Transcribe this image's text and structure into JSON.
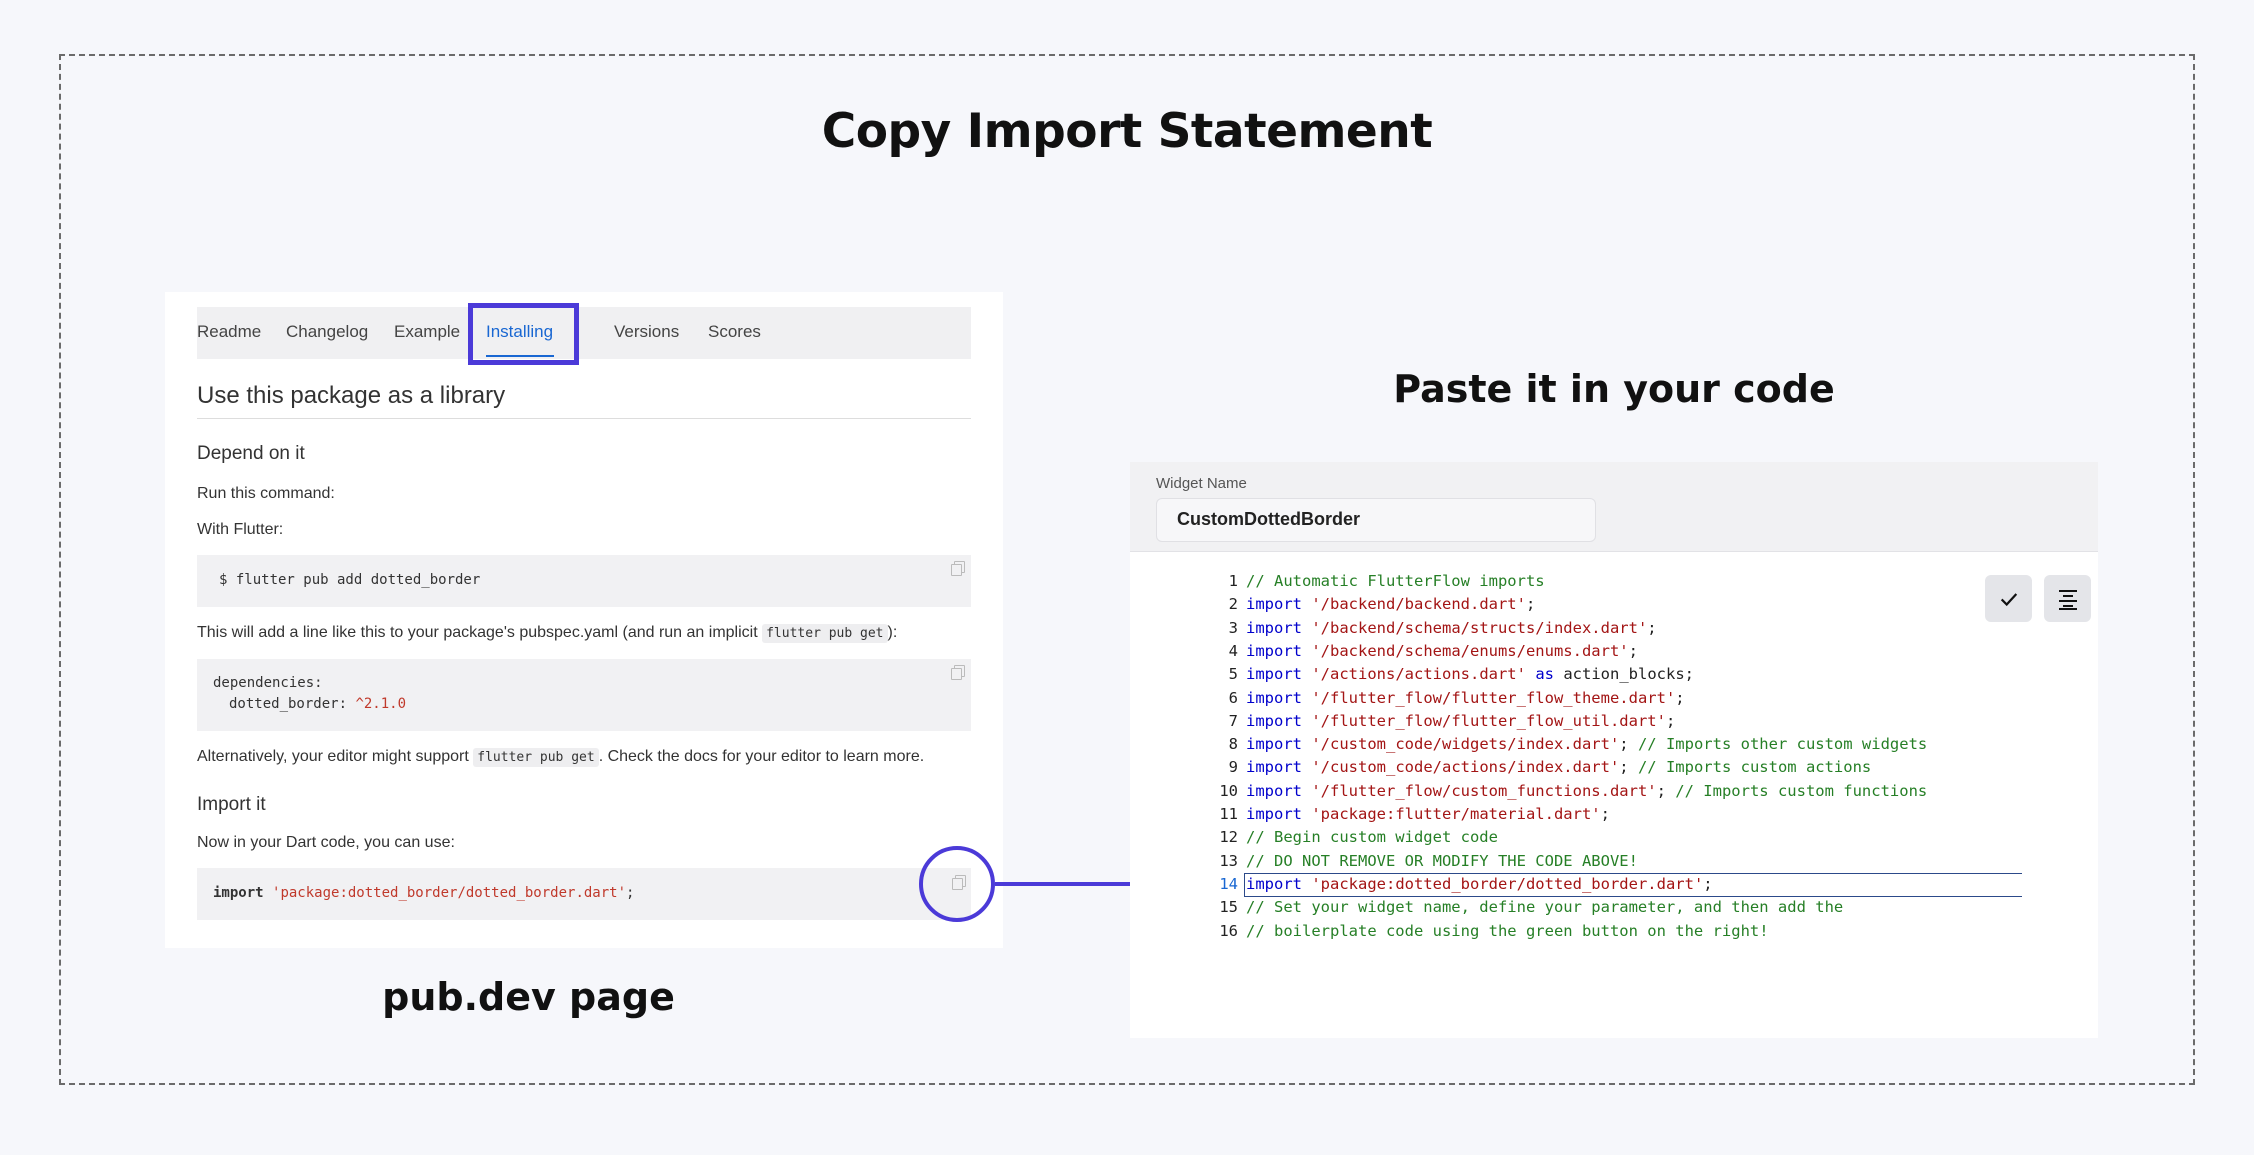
{
  "main_title": "Copy Import Statement",
  "pub_caption": "pub.dev page",
  "paste_title": "Paste it in your code",
  "pub_page": {
    "tabs": [
      {
        "label": "Readme",
        "active": false
      },
      {
        "label": "Changelog",
        "active": false
      },
      {
        "label": "Example",
        "active": false
      },
      {
        "label": "Installing",
        "active": true
      },
      {
        "label": "Versions",
        "active": false
      },
      {
        "label": "Scores",
        "active": false
      }
    ],
    "heading": "Use this package as a library",
    "depend_heading": "Depend on it",
    "run_command": "Run this command:",
    "with_flutter": "With Flutter:",
    "command": "$ flutter pub add dotted_border",
    "will_add_before": "This will add a line like this to your package's pubspec.yaml (and run an implicit ",
    "will_add_code": "flutter pub get",
    "will_add_after": "):",
    "deps_key": "dependencies:",
    "deps_name": "dotted_border: ",
    "deps_version": "^2.1.0",
    "alt_before": "Alternatively, your editor might support ",
    "alt_code": "flutter pub get",
    "alt_after": ". Check the docs for your editor to learn more.",
    "import_heading": "Import it",
    "now_in_dart": "Now in your Dart code, you can use:",
    "import_kw": "import",
    "import_str": "'package:dotted_border/dotted_border.dart'",
    "import_semi": ";"
  },
  "editor": {
    "widget_name_label": "Widget Name",
    "widget_name_value": "CustomDottedBorder",
    "check_icon": "check-icon",
    "format_icon": "align-center-icon",
    "highlighted_line": 14,
    "lines": [
      {
        "n": "1",
        "parts": [
          {
            "t": "// Automatic FlutterFlow imports",
            "c": "cm"
          }
        ]
      },
      {
        "n": "2",
        "parts": [
          {
            "t": "import",
            "c": "kw"
          },
          {
            "t": " ",
            "c": ""
          },
          {
            "t": "'/backend/backend.dart'",
            "c": "str"
          },
          {
            "t": ";",
            "c": ""
          }
        ]
      },
      {
        "n": "3",
        "parts": [
          {
            "t": "import",
            "c": "kw"
          },
          {
            "t": " ",
            "c": ""
          },
          {
            "t": "'/backend/schema/structs/index.dart'",
            "c": "str"
          },
          {
            "t": ";",
            "c": ""
          }
        ]
      },
      {
        "n": "4",
        "parts": [
          {
            "t": "import",
            "c": "kw"
          },
          {
            "t": " ",
            "c": ""
          },
          {
            "t": "'/backend/schema/enums/enums.dart'",
            "c": "str"
          },
          {
            "t": ";",
            "c": ""
          }
        ]
      },
      {
        "n": "5",
        "parts": [
          {
            "t": "import",
            "c": "kw"
          },
          {
            "t": " ",
            "c": ""
          },
          {
            "t": "'/actions/actions.dart'",
            "c": "str"
          },
          {
            "t": " ",
            "c": ""
          },
          {
            "t": "as",
            "c": "kw"
          },
          {
            "t": " action_blocks;",
            "c": ""
          }
        ]
      },
      {
        "n": "6",
        "parts": [
          {
            "t": "import",
            "c": "kw"
          },
          {
            "t": " ",
            "c": ""
          },
          {
            "t": "'/flutter_flow/flutter_flow_theme.dart'",
            "c": "str"
          },
          {
            "t": ";",
            "c": ""
          }
        ]
      },
      {
        "n": "7",
        "parts": [
          {
            "t": "import",
            "c": "kw"
          },
          {
            "t": " ",
            "c": ""
          },
          {
            "t": "'/flutter_flow/flutter_flow_util.dart'",
            "c": "str"
          },
          {
            "t": ";",
            "c": ""
          }
        ]
      },
      {
        "n": "8",
        "parts": [
          {
            "t": "import",
            "c": "kw"
          },
          {
            "t": " ",
            "c": ""
          },
          {
            "t": "'/custom_code/widgets/index.dart'",
            "c": "str"
          },
          {
            "t": "; ",
            "c": ""
          },
          {
            "t": "// Imports other custom widgets",
            "c": "cm"
          }
        ]
      },
      {
        "n": "9",
        "parts": [
          {
            "t": "import",
            "c": "kw"
          },
          {
            "t": " ",
            "c": ""
          },
          {
            "t": "'/custom_code/actions/index.dart'",
            "c": "str"
          },
          {
            "t": "; ",
            "c": ""
          },
          {
            "t": "// Imports custom actions",
            "c": "cm"
          }
        ]
      },
      {
        "n": "10",
        "parts": [
          {
            "t": "import",
            "c": "kw"
          },
          {
            "t": " ",
            "c": ""
          },
          {
            "t": "'/flutter_flow/custom_functions.dart'",
            "c": "str"
          },
          {
            "t": "; ",
            "c": ""
          },
          {
            "t": "// Imports custom functions",
            "c": "cm"
          }
        ]
      },
      {
        "n": "11",
        "parts": [
          {
            "t": "import",
            "c": "kw"
          },
          {
            "t": " ",
            "c": ""
          },
          {
            "t": "'package:flutter/material.dart'",
            "c": "str"
          },
          {
            "t": ";",
            "c": ""
          }
        ]
      },
      {
        "n": "12",
        "parts": [
          {
            "t": "// Begin custom widget code",
            "c": "cm"
          }
        ]
      },
      {
        "n": "13",
        "parts": [
          {
            "t": "// DO NOT REMOVE OR MODIFY THE CODE ABOVE!",
            "c": "cm"
          }
        ]
      },
      {
        "n": "14",
        "parts": [
          {
            "t": "import",
            "c": "kw"
          },
          {
            "t": " ",
            "c": ""
          },
          {
            "t": "'package:dotted_border/dotted_border.dart'",
            "c": "str"
          },
          {
            "t": ";",
            "c": ""
          }
        ]
      },
      {
        "n": "15",
        "parts": [
          {
            "t": "// Set your widget name, define your parameter, and then add the",
            "c": "cm"
          }
        ]
      },
      {
        "n": "16",
        "parts": [
          {
            "t": "// boilerplate code using the green button on the right!",
            "c": "cm"
          }
        ]
      }
    ]
  }
}
